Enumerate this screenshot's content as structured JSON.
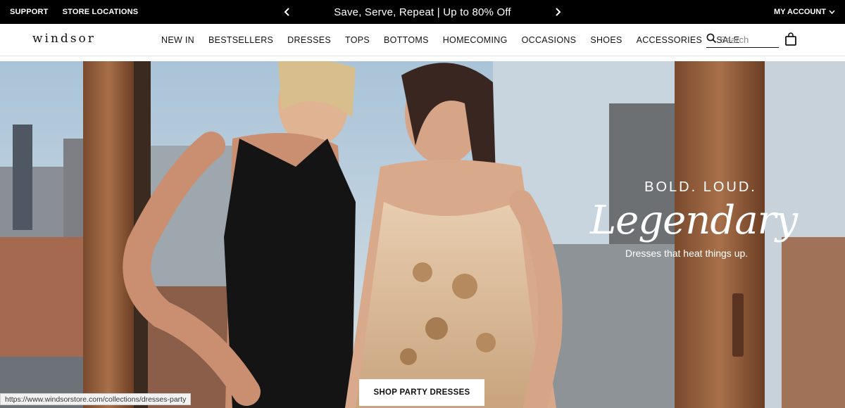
{
  "topbar": {
    "support": "SUPPORT",
    "store_locations": "STORE LOCATIONS",
    "promo_text": "Save, Serve, Repeat | Up to 80% Off",
    "account": "MY ACCOUNT"
  },
  "header": {
    "logo": "WINDSOR",
    "nav": [
      "NEW IN",
      "BESTSELLERS",
      "DRESSES",
      "TOPS",
      "BOTTOMS",
      "HOMECOMING",
      "OCCASIONS",
      "SHOES",
      "ACCESSORIES",
      "SALE"
    ],
    "search_placeholder": "Search"
  },
  "hero": {
    "headline": "BOLD. LOUD.",
    "script": "Legendary",
    "subtitle": "Dresses that heat things up.",
    "cta": "SHOP PARTY DRESSES"
  },
  "status_url": "https://www.windsorstore.com/collections/dresses-party",
  "icons": [
    "chevron-left-icon",
    "chevron-right-icon",
    "chevron-down-icon",
    "search-icon",
    "shopping-bag-icon"
  ],
  "colors": {
    "topbar_bg": "#000000",
    "header_bg": "#ffffff",
    "cta_bg": "#ffffff",
    "hero_text": "#ffffff"
  }
}
